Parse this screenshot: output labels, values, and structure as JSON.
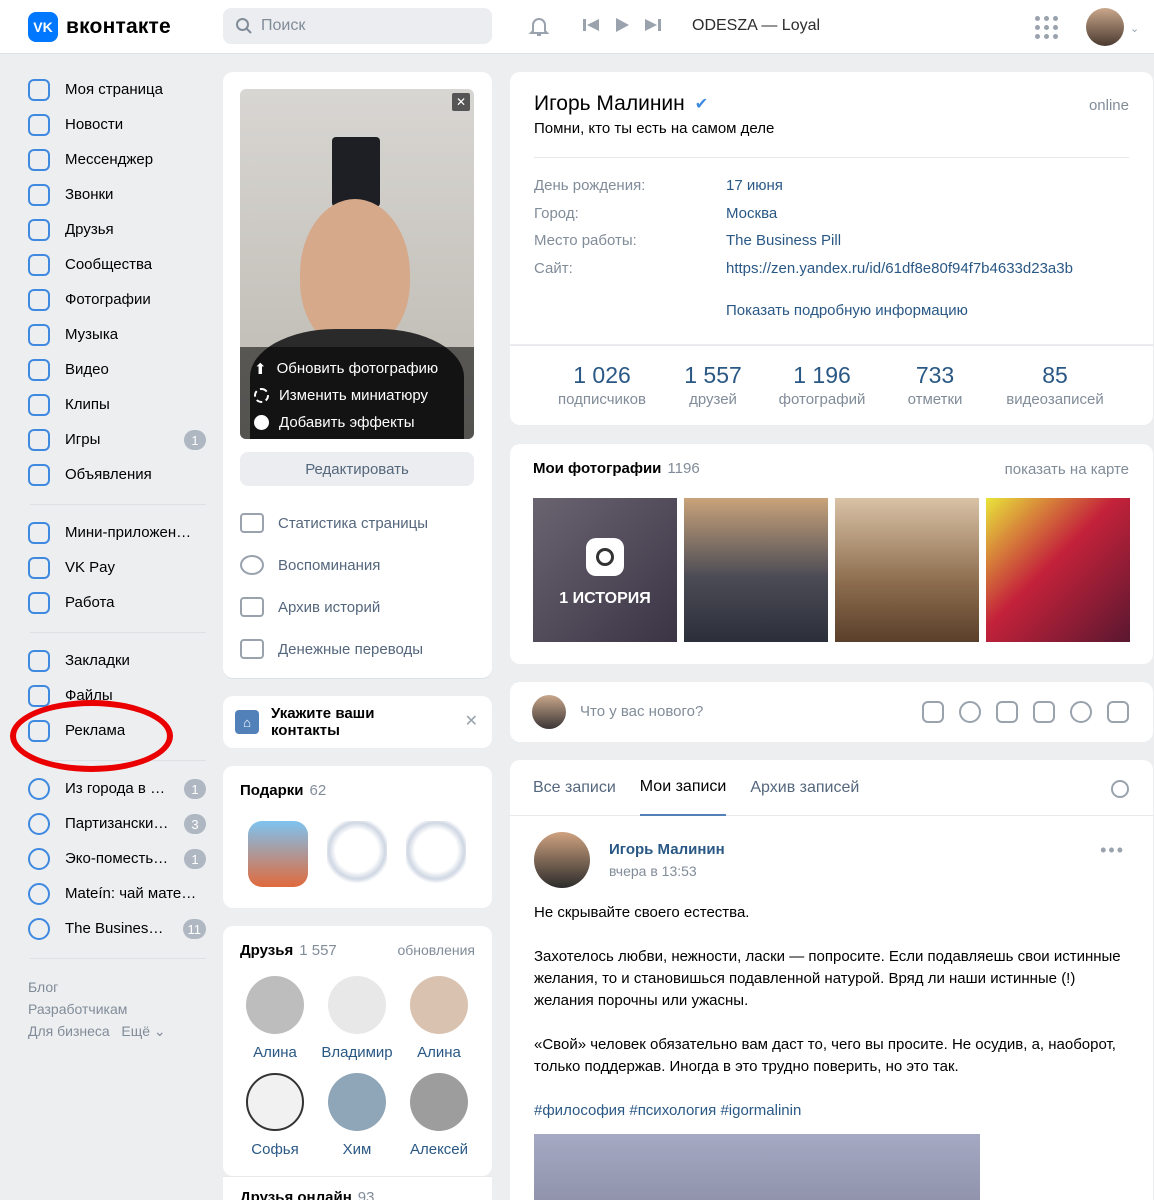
{
  "header": {
    "logo_text": "вконтакте",
    "search_placeholder": "Поиск",
    "now_playing": "ODESZA — Loyal"
  },
  "nav": {
    "main": [
      {
        "label": "Моя страница",
        "icon": "user-icon"
      },
      {
        "label": "Новости",
        "icon": "news-icon"
      },
      {
        "label": "Мессенджер",
        "icon": "message-icon"
      },
      {
        "label": "Звонки",
        "icon": "phone-icon"
      },
      {
        "label": "Друзья",
        "icon": "friends-icon"
      },
      {
        "label": "Сообщества",
        "icon": "community-icon"
      },
      {
        "label": "Фотографии",
        "icon": "photo-icon"
      },
      {
        "label": "Музыка",
        "icon": "music-icon"
      },
      {
        "label": "Видео",
        "icon": "video-icon"
      },
      {
        "label": "Клипы",
        "icon": "clips-icon"
      },
      {
        "label": "Игры",
        "icon": "games-icon",
        "badge": "1"
      },
      {
        "label": "Объявления",
        "icon": "ads-icon"
      }
    ],
    "apps": [
      {
        "label": "Мини-приложен…",
        "icon": "apps-icon"
      },
      {
        "label": "VK Pay",
        "icon": "vkpay-icon"
      },
      {
        "label": "Работа",
        "icon": "work-icon"
      }
    ],
    "misc": [
      {
        "label": "Закладки",
        "icon": "bookmark-icon"
      },
      {
        "label": "Файлы",
        "icon": "file-icon"
      },
      {
        "label": "Реклама",
        "icon": "megaphone-icon"
      }
    ],
    "groups": [
      {
        "label": "Из города в …",
        "badge": "1"
      },
      {
        "label": "Партизански…",
        "badge": "3"
      },
      {
        "label": "Эко-поместь…",
        "badge": "1"
      },
      {
        "label": "Mateín: чай мате…",
        "badge": ""
      },
      {
        "label": "The Busines…",
        "badge": "11"
      }
    ],
    "footer": [
      "Блог",
      "Разработчикам",
      "Для бизнеса",
      "Ещё"
    ]
  },
  "avatar_menu": [
    "Обновить фотографию",
    "Изменить миниатюру",
    "Добавить эффекты"
  ],
  "edit_label": "Редактировать",
  "side_links": [
    "Статистика страницы",
    "Воспоминания",
    "Архив историй",
    "Денежные переводы"
  ],
  "contacts_prompt": "Укажите ваши контакты",
  "gifts": {
    "title": "Подарки",
    "count": "62"
  },
  "friends": {
    "title": "Друзья",
    "count": "1 557",
    "updates": "обновления",
    "list": [
      "Алина",
      "Владимир",
      "Алина",
      "Софья",
      "Хим",
      "Алексей"
    ],
    "online_title": "Друзья онлайн",
    "online_count": "93"
  },
  "profile": {
    "name": "Игорь Малинин",
    "status": "Помни, кто ты есть на самом деле",
    "online": "online",
    "info": [
      {
        "key": "День рождения:",
        "value": "17 июня"
      },
      {
        "key": "Город:",
        "value": "Москва"
      },
      {
        "key": "Место работы:",
        "value": "The Business Pill"
      },
      {
        "key": "Сайт:",
        "value": "https://zen.yandex.ru/id/61df8e80f94f7b4633d23a3b"
      }
    ],
    "more": "Показать подробную информацию",
    "stats": [
      {
        "n": "1 026",
        "l": "подписчиков"
      },
      {
        "n": "1 557",
        "l": "друзей"
      },
      {
        "n": "1 196",
        "l": "фотографий"
      },
      {
        "n": "733",
        "l": "отметки"
      },
      {
        "n": "85",
        "l": "видеозаписей"
      }
    ]
  },
  "photos": {
    "title": "Мои фотографии",
    "count": "1196",
    "map_link": "показать на карте",
    "story_label": "1 ИСТОРИЯ"
  },
  "composer_placeholder": "Что у вас нового?",
  "wall": {
    "tabs": [
      "Все записи",
      "Мои записи",
      "Архив записей"
    ],
    "active_tab": 1,
    "post": {
      "author": "Игорь Малинин",
      "time": "вчера в 13:53",
      "paragraphs": [
        "Не скрывайте своего естества.",
        "Захотелось любви, нежности, ласки — попросите. Если подавляешь свои истинные желания, то и становишься подавленной натурой. Вряд ли наши истинные (!) желания порочны или ужасны.",
        "«Свой» человек обязательно вам даст то, чего вы просите. Не осудив, а, наоборот, только поддержав. Иногда в это трудно поверить, но это так."
      ],
      "tags": "#философия #психология #igormalinin"
    }
  },
  "colors": {
    "accent": "#0077ff",
    "link": "#2a5885",
    "highlight": "#ea0000"
  }
}
